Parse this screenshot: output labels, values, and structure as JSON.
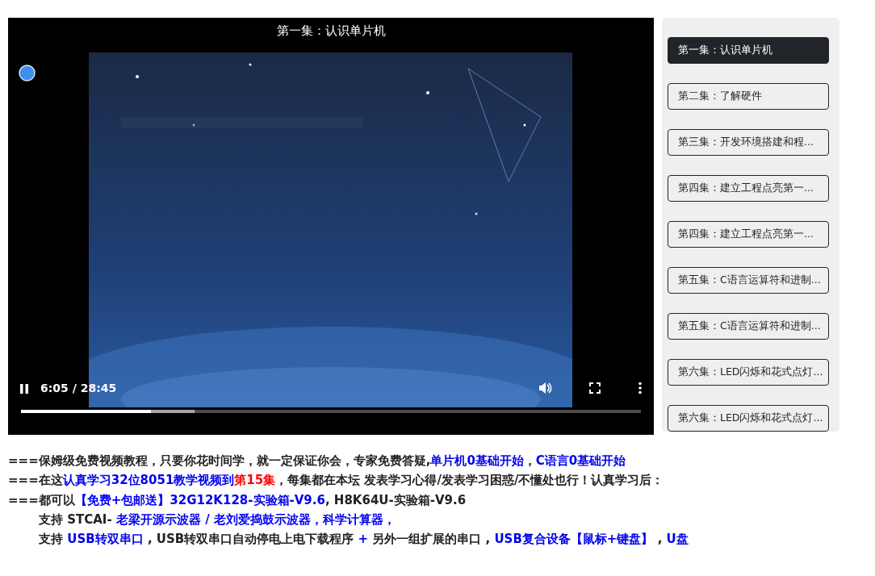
{
  "video": {
    "title": "第一集：认识单片机",
    "kind": "picture",
    "playing": true,
    "time": "6:05 / 28:45",
    "progress": {
      "level": 0.21,
      "buffered": {
        "level": 0.28
      }
    }
  },
  "playlist": [
    {
      "label": "第一集：认识单片机",
      "selected": true
    },
    {
      "label": "第二集：了解硬件",
      "selected": false
    },
    {
      "label": "第三集：开发环境搭建和程...",
      "selected": false
    },
    {
      "label": "第四集：建立工程点亮第一...",
      "selected": false
    },
    {
      "label": "第四集：建立工程点亮第一...",
      "selected": false
    },
    {
      "label": "第五集：C语言运算符和进制...",
      "selected": false
    },
    {
      "label": "第五集：C语言运算符和进制...",
      "selected": false
    },
    {
      "label": "第六集：LED闪烁和花式点灯...",
      "selected": false
    },
    {
      "label": "第六集：LED闪烁和花式点灯...",
      "selected": false
    }
  ],
  "notes": [
    {
      "indent": false,
      "segments": [
        {
          "kind": "plain",
          "text": "===保姆级免费视频教程，只要你花时间学，就一定保证你会，专家免费答疑,"
        },
        {
          "kind": "link",
          "text": "单片机0基础开始"
        },
        {
          "kind": "plain",
          "text": "，"
        },
        {
          "kind": "link",
          "text": "C语言0基础开始"
        }
      ]
    },
    {
      "indent": false,
      "segments": [
        {
          "kind": "plain",
          "text": "===在这"
        },
        {
          "kind": "link",
          "text": "认真学习32位8051教学视频到"
        },
        {
          "kind": "highlight",
          "text": "第15集"
        },
        {
          "kind": "plain",
          "text": "，每集都在本坛 发表学习心得/发表学习困惑/不懂处也行！认真学习后："
        }
      ]
    },
    {
      "indent": false,
      "segments": [
        {
          "kind": "plain",
          "text": "===都可以"
        },
        {
          "kind": "link",
          "text": "【免费+包邮送】32G12K128-实验箱-V9.6"
        },
        {
          "kind": "plain",
          "text": ", H8K64U-实验箱-V9.6"
        }
      ]
    },
    {
      "indent": true,
      "segments": [
        {
          "kind": "plain",
          "text": "支持 STCAI-"
        },
        {
          "kind": "link",
          "text": "老梁开源示波器 / 老刘爱捣鼓示波器，科学计算器，"
        }
      ]
    },
    {
      "indent": true,
      "segments": [
        {
          "kind": "plain",
          "text": "支持"
        },
        {
          "kind": "link",
          "text": "USB转双串口"
        },
        {
          "kind": "plain",
          "text": ", USB转双串口自动停电上电下载程序"
        },
        {
          "kind": "link",
          "text": "+"
        },
        {
          "kind": "plain",
          "text": "另外一组扩展的串口 ,"
        },
        {
          "kind": "link",
          "text": "USB复合设备【鼠标+键盘】"
        },
        {
          "kind": "plain",
          "text": ","
        },
        {
          "kind": "link",
          "text": "U盘"
        }
      ]
    }
  ]
}
